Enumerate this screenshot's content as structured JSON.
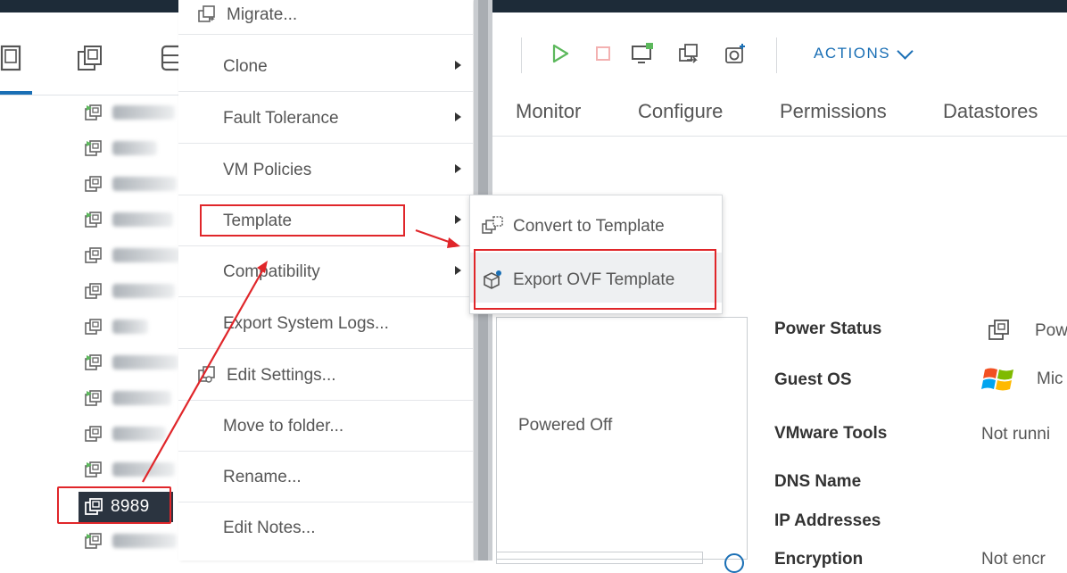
{
  "context_menu": {
    "items": [
      {
        "label": "Migrate...",
        "icon": "migrate-icon",
        "submenu": false
      },
      {
        "label": "Clone",
        "submenu": true
      },
      {
        "label": "Fault Tolerance",
        "submenu": true
      },
      {
        "label": "VM Policies",
        "submenu": true
      },
      {
        "label": "Template",
        "submenu": true
      },
      {
        "label": "Compatibility",
        "submenu": true
      },
      {
        "label": "Export System Logs...",
        "submenu": false
      },
      {
        "label": "Edit Settings...",
        "icon": "edit-settings-icon",
        "submenu": false
      },
      {
        "label": "Move to folder...",
        "submenu": false
      },
      {
        "label": "Rename...",
        "submenu": false
      },
      {
        "label": "Edit Notes...",
        "submenu": false
      }
    ]
  },
  "submenu": {
    "items": [
      {
        "label": "Convert to Template",
        "icon": "convert-template-icon"
      },
      {
        "label": "Export OVF Template",
        "icon": "export-ovf-icon",
        "highlighted": true
      }
    ]
  },
  "left_nav": {
    "tabs": [
      "hosts-clusters-icon",
      "vms-templates-icon",
      "storage-icon"
    ],
    "selected_vm": "8989"
  },
  "toolbar": {
    "icons": [
      "power-on-icon",
      "power-off-icon",
      "launch-console-icon",
      "migrate-icon",
      "snapshot-icon"
    ],
    "actions_label": "ACTIONS"
  },
  "tabs": [
    "Monitor",
    "Configure",
    "Permissions",
    "Datastores"
  ],
  "summary": {
    "thumbnail_text": "Powered Off",
    "properties": [
      {
        "label": "Power Status",
        "value": "Pow"
      },
      {
        "label": "Guest OS",
        "value": "Mic"
      },
      {
        "label": "VMware Tools",
        "value": "Not runni"
      },
      {
        "label": "DNS Name",
        "value": ""
      },
      {
        "label": "IP Addresses",
        "value": ""
      },
      {
        "label": "Encryption",
        "value": "Not encr"
      }
    ]
  },
  "colors": {
    "accent": "#1a6fb5",
    "annotation_red": "#e0262a",
    "header_dark": "#1d2b38",
    "power_on_green": "#5cb85c"
  }
}
